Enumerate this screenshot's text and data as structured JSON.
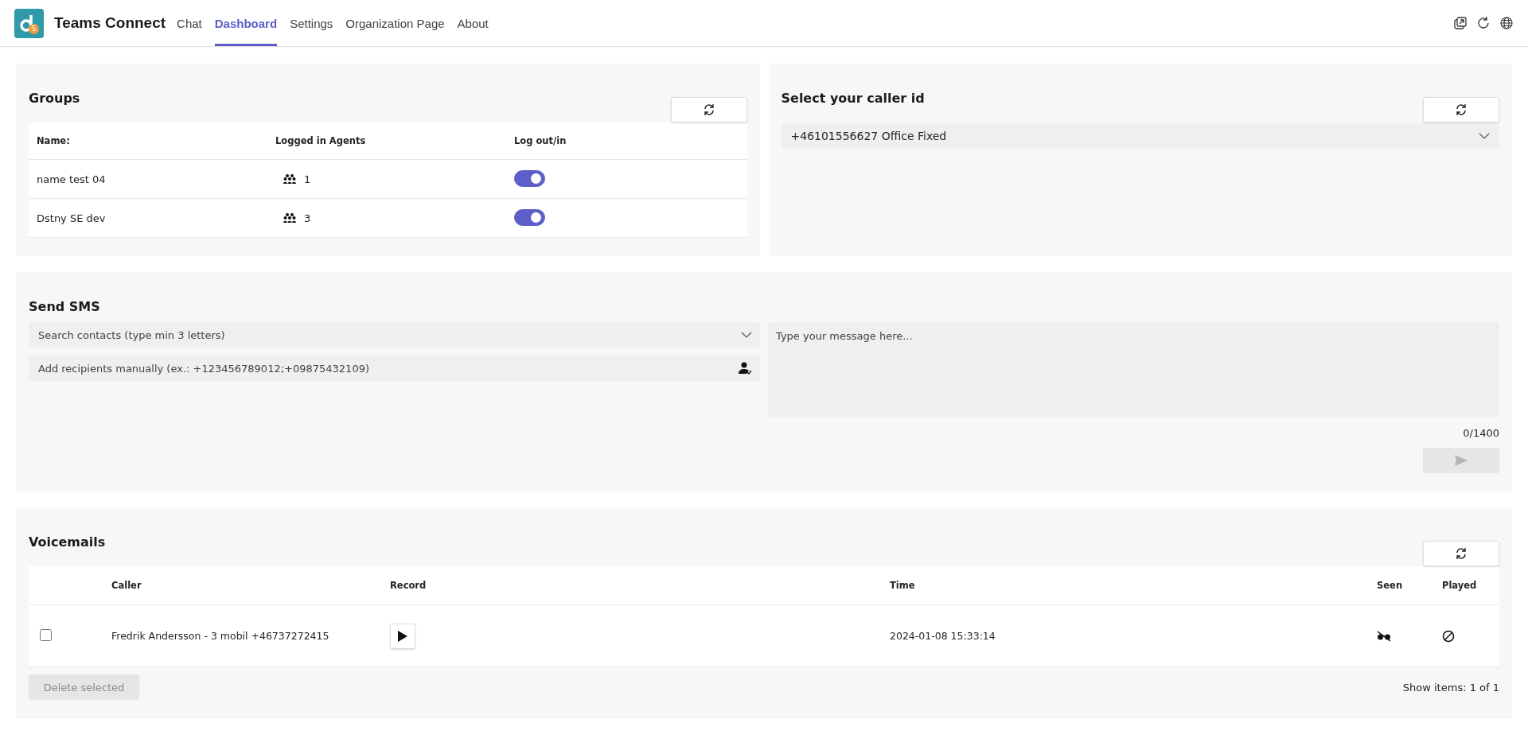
{
  "app": {
    "title": "Teams Connect",
    "logo_badge": "S"
  },
  "tabs": [
    {
      "label": "Chat",
      "selected": false
    },
    {
      "label": "Dashboard",
      "selected": true
    },
    {
      "label": "Settings",
      "selected": false
    },
    {
      "label": "Organization Page",
      "selected": false
    },
    {
      "label": "About",
      "selected": false
    }
  ],
  "groups": {
    "title": "Groups",
    "columns": [
      "Name:",
      "Logged in Agents",
      "Log out/in"
    ],
    "rows": [
      {
        "name": "name test 04",
        "agents": "1",
        "on": true
      },
      {
        "name": "Dstny SE dev",
        "agents": "3",
        "on": true
      }
    ]
  },
  "caller_id": {
    "title": "Select your caller id",
    "value": "+46101556627 Office Fixed"
  },
  "sms": {
    "title": "Send SMS",
    "contacts_placeholder": "Search contacts (type min 3 letters)",
    "recipients_placeholder": "Add recipients manually (ex.: +123456789012;+09875432109)",
    "message_placeholder": "Type your message here...",
    "counter": "0/1400",
    "send_disabled": true
  },
  "voicemails": {
    "title": "Voicemails",
    "columns": [
      "Caller",
      "Record",
      "Time",
      "Seen",
      "Played"
    ],
    "rows": [
      {
        "checked": false,
        "caller": "Fredrik Andersson - 3 mobil +46737272415",
        "time": "2024-01-08 15:33:14",
        "seen": false,
        "played": false
      }
    ],
    "delete_label": "Delete selected",
    "delete_disabled": true,
    "pager": "Show items: 1 of 1"
  }
}
